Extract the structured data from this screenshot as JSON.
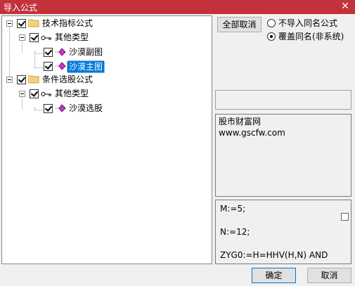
{
  "window": {
    "title": "导入公式",
    "close_glyph": "✕"
  },
  "tree": {
    "nodes": [
      {
        "label": "技术指标公式",
        "checked": true
      },
      {
        "label": "其他类型",
        "checked": true
      },
      {
        "label": "沙漠副图",
        "checked": true
      },
      {
        "label": "沙漠主图",
        "checked": true,
        "selected": true
      },
      {
        "label": "条件选股公式",
        "checked": true
      },
      {
        "label": "其他类型",
        "checked": true
      },
      {
        "label": "沙漠选股",
        "checked": true
      }
    ]
  },
  "options": {
    "cancel_all_label": "全部取消",
    "radio_skip_label": "不导入同名公式",
    "radio_overwrite_label": "覆盖同名(非系统)",
    "selected": "overwrite"
  },
  "description": {
    "line1": "股市财富网",
    "line2": "www.gscfw.com"
  },
  "formula": {
    "line1": "M:=5;",
    "line2": "N:=12;",
    "line3": "ZYG0:=H=HHV(H,N) AND"
  },
  "footer": {
    "ok_label": "确定",
    "cancel_label": "取消"
  },
  "colors": {
    "titlebar": "#c4313b",
    "selection": "#0078d7",
    "folder": "#f5d27a",
    "gem": "#cc33cc"
  }
}
